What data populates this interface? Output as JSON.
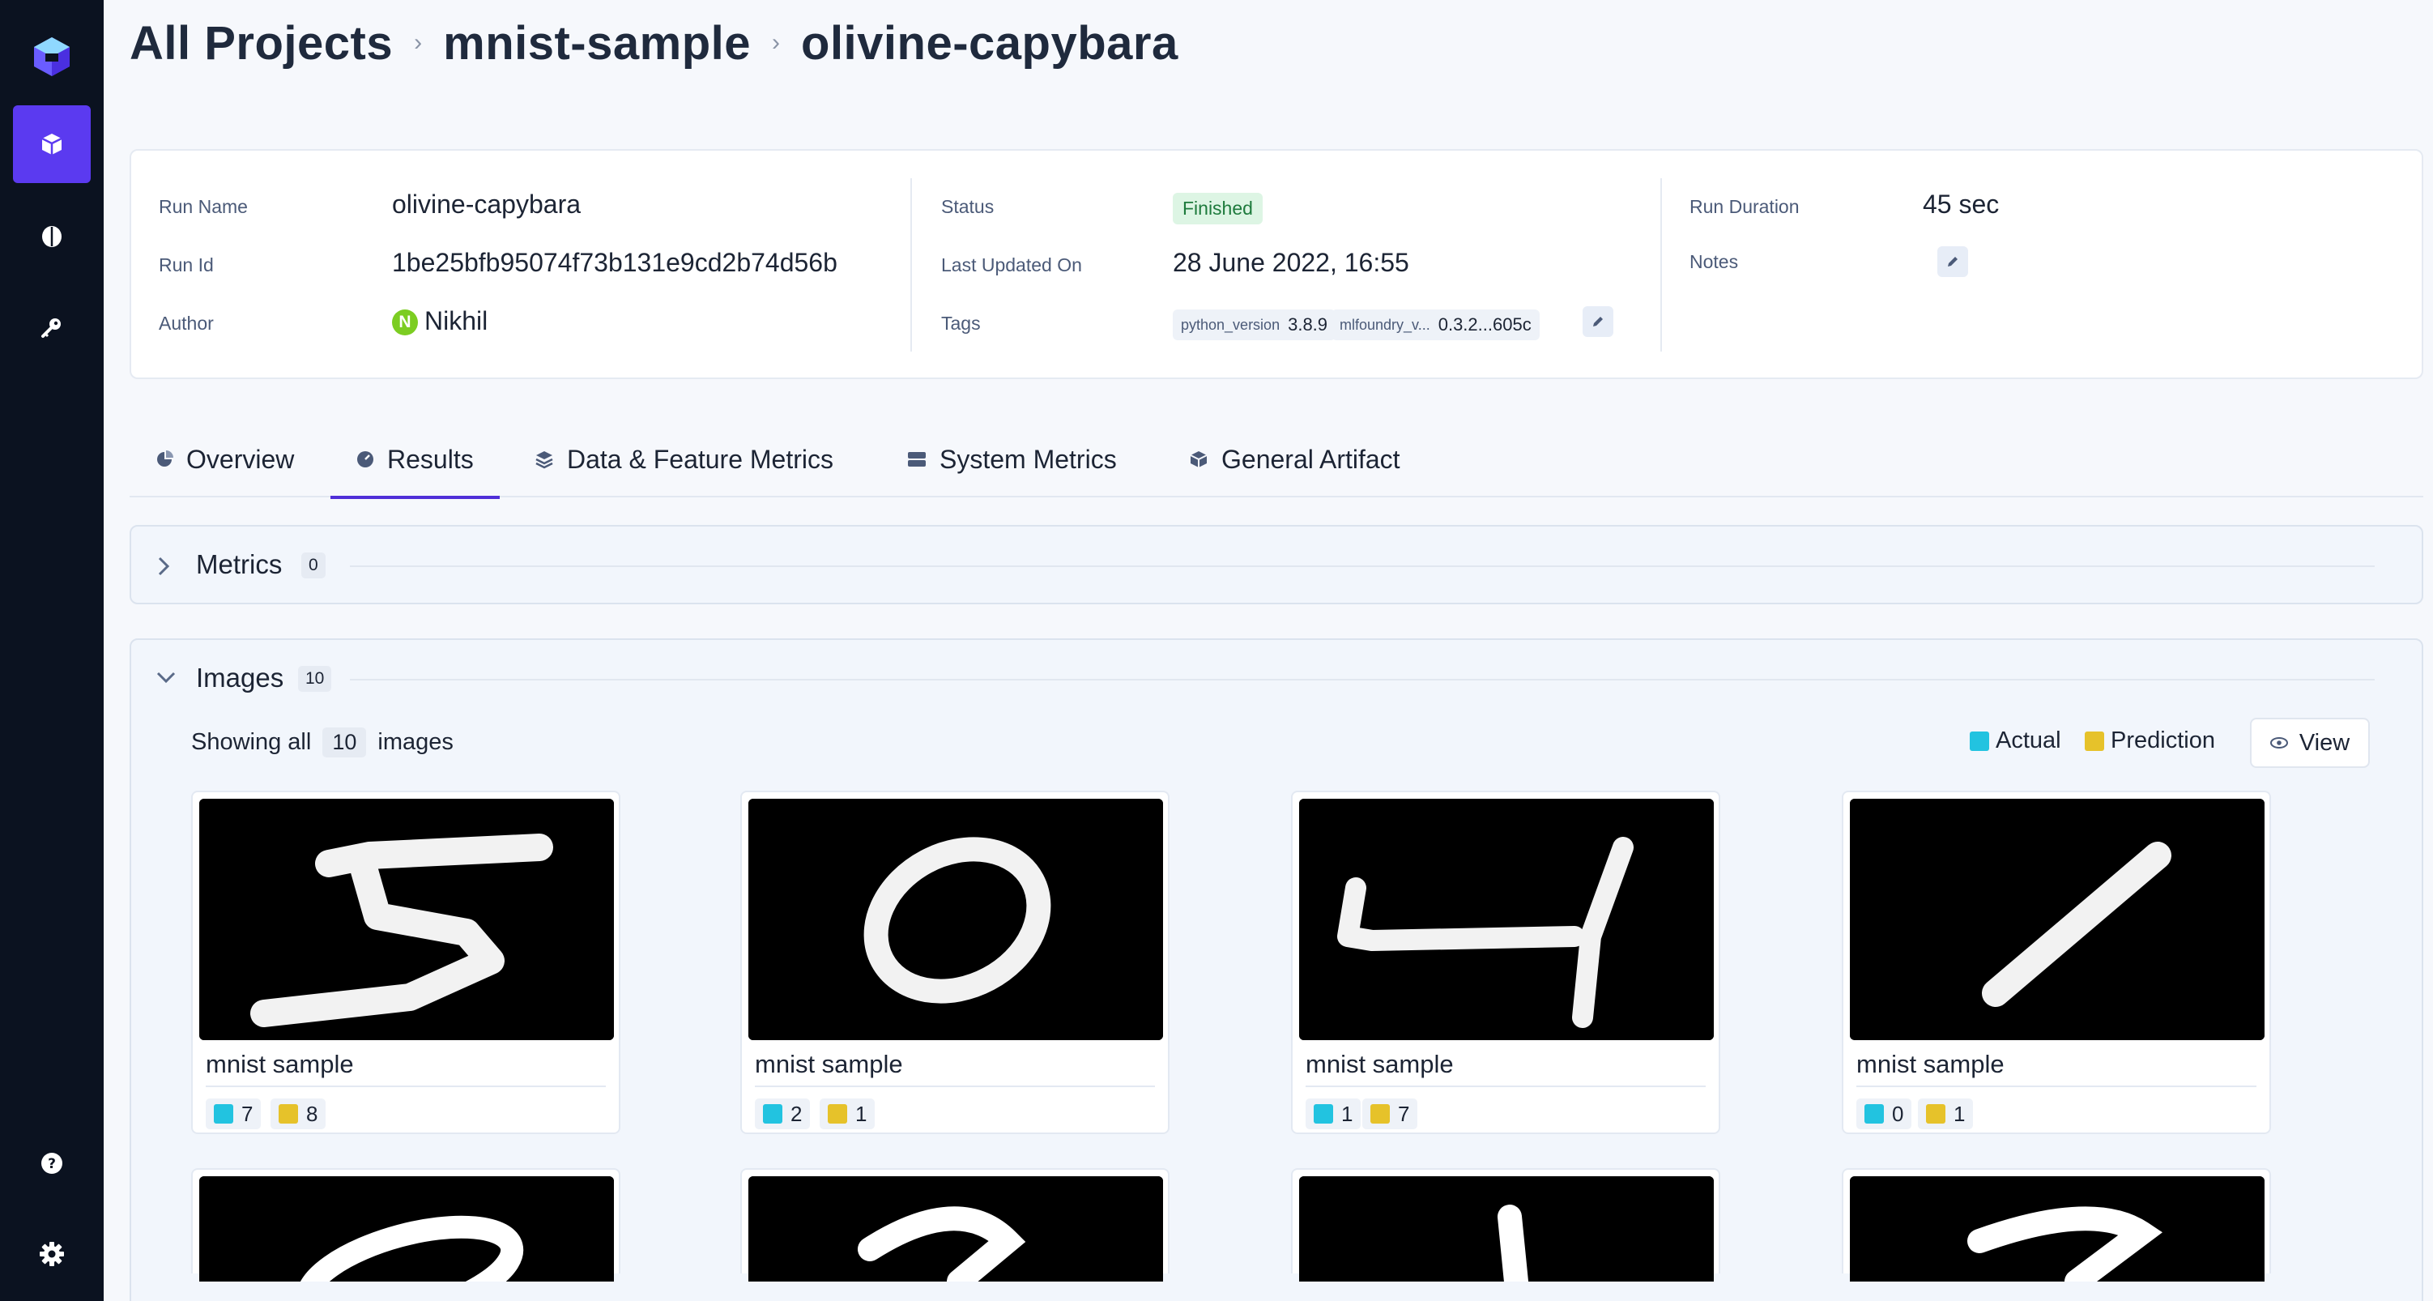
{
  "breadcrumb": [
    "All Projects",
    "mnist-sample",
    "olivine-capybara"
  ],
  "run": {
    "run_name_label": "Run Name",
    "run_name": "olivine-capybara",
    "run_id_label": "Run Id",
    "run_id": "1be25bfb95074f73b131e9cd2b74d56b",
    "author_label": "Author",
    "author_initial": "N",
    "author": "Nikhil",
    "status_label": "Status",
    "status": "Finished",
    "updated_label": "Last Updated On",
    "updated": "28 June 2022, 16:55",
    "tags_label": "Tags",
    "tags": [
      {
        "key": "python_version",
        "value": "3.8.9"
      },
      {
        "key": "mlfoundry_v...",
        "value": "0.3.2...605c"
      }
    ],
    "duration_label": "Run Duration",
    "duration": "45 sec",
    "notes_label": "Notes"
  },
  "tabs": [
    "Overview",
    "Results",
    "Data & Feature Metrics",
    "System Metrics",
    "General Artifact"
  ],
  "active_tab": "Results",
  "metrics_panel": {
    "title": "Metrics",
    "count": "0"
  },
  "images_panel": {
    "title": "Images",
    "count": "10",
    "showing_prefix": "Showing all",
    "showing_count": "10",
    "showing_suffix": "images",
    "legend_actual": "Actual",
    "legend_prediction": "Prediction",
    "view_label": "View"
  },
  "colors": {
    "actual": "#22c3e0",
    "prediction": "#e6c22a",
    "accent": "#5b3af0"
  },
  "image_cards": [
    {
      "caption": "mnist sample",
      "actual": "7",
      "prediction": "8",
      "digit": "5"
    },
    {
      "caption": "mnist sample",
      "actual": "2",
      "prediction": "1",
      "digit": "0"
    },
    {
      "caption": "mnist sample",
      "actual": "1",
      "prediction": "7",
      "digit": "4"
    },
    {
      "caption": "mnist sample",
      "actual": "0",
      "prediction": "1",
      "digit": "1"
    }
  ],
  "sidebar_icons": [
    "logo-icon",
    "projects-icon",
    "models-icon",
    "secrets-icon",
    "help-icon",
    "settings-icon"
  ]
}
